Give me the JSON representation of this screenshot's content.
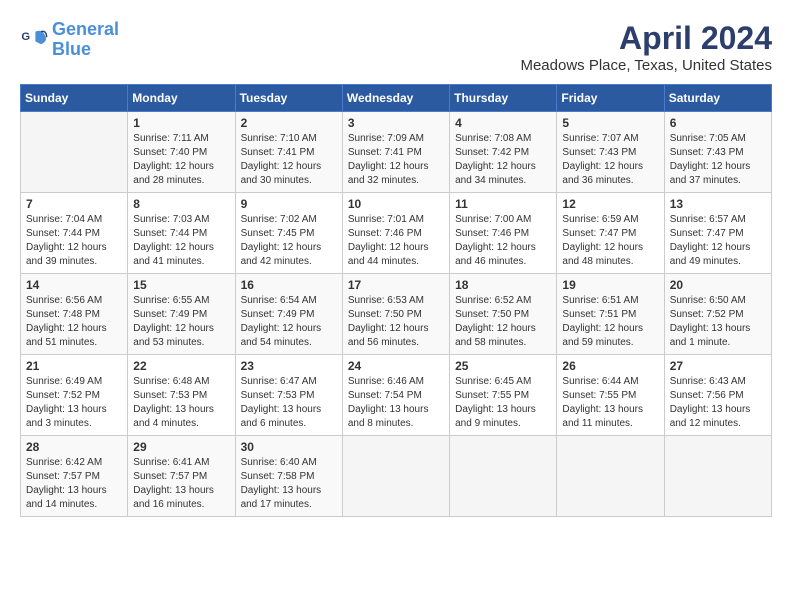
{
  "logo": {
    "line1": "General",
    "line2": "Blue"
  },
  "title": "April 2024",
  "location": "Meadows Place, Texas, United States",
  "days_header": [
    "Sunday",
    "Monday",
    "Tuesday",
    "Wednesday",
    "Thursday",
    "Friday",
    "Saturday"
  ],
  "weeks": [
    [
      {
        "day": "",
        "sunrise": "",
        "sunset": "",
        "daylight": ""
      },
      {
        "day": "1",
        "sunrise": "Sunrise: 7:11 AM",
        "sunset": "Sunset: 7:40 PM",
        "daylight": "Daylight: 12 hours and 28 minutes."
      },
      {
        "day": "2",
        "sunrise": "Sunrise: 7:10 AM",
        "sunset": "Sunset: 7:41 PM",
        "daylight": "Daylight: 12 hours and 30 minutes."
      },
      {
        "day": "3",
        "sunrise": "Sunrise: 7:09 AM",
        "sunset": "Sunset: 7:41 PM",
        "daylight": "Daylight: 12 hours and 32 minutes."
      },
      {
        "day": "4",
        "sunrise": "Sunrise: 7:08 AM",
        "sunset": "Sunset: 7:42 PM",
        "daylight": "Daylight: 12 hours and 34 minutes."
      },
      {
        "day": "5",
        "sunrise": "Sunrise: 7:07 AM",
        "sunset": "Sunset: 7:43 PM",
        "daylight": "Daylight: 12 hours and 36 minutes."
      },
      {
        "day": "6",
        "sunrise": "Sunrise: 7:05 AM",
        "sunset": "Sunset: 7:43 PM",
        "daylight": "Daylight: 12 hours and 37 minutes."
      }
    ],
    [
      {
        "day": "7",
        "sunrise": "Sunrise: 7:04 AM",
        "sunset": "Sunset: 7:44 PM",
        "daylight": "Daylight: 12 hours and 39 minutes."
      },
      {
        "day": "8",
        "sunrise": "Sunrise: 7:03 AM",
        "sunset": "Sunset: 7:44 PM",
        "daylight": "Daylight: 12 hours and 41 minutes."
      },
      {
        "day": "9",
        "sunrise": "Sunrise: 7:02 AM",
        "sunset": "Sunset: 7:45 PM",
        "daylight": "Daylight: 12 hours and 42 minutes."
      },
      {
        "day": "10",
        "sunrise": "Sunrise: 7:01 AM",
        "sunset": "Sunset: 7:46 PM",
        "daylight": "Daylight: 12 hours and 44 minutes."
      },
      {
        "day": "11",
        "sunrise": "Sunrise: 7:00 AM",
        "sunset": "Sunset: 7:46 PM",
        "daylight": "Daylight: 12 hours and 46 minutes."
      },
      {
        "day": "12",
        "sunrise": "Sunrise: 6:59 AM",
        "sunset": "Sunset: 7:47 PM",
        "daylight": "Daylight: 12 hours and 48 minutes."
      },
      {
        "day": "13",
        "sunrise": "Sunrise: 6:57 AM",
        "sunset": "Sunset: 7:47 PM",
        "daylight": "Daylight: 12 hours and 49 minutes."
      }
    ],
    [
      {
        "day": "14",
        "sunrise": "Sunrise: 6:56 AM",
        "sunset": "Sunset: 7:48 PM",
        "daylight": "Daylight: 12 hours and 51 minutes."
      },
      {
        "day": "15",
        "sunrise": "Sunrise: 6:55 AM",
        "sunset": "Sunset: 7:49 PM",
        "daylight": "Daylight: 12 hours and 53 minutes."
      },
      {
        "day": "16",
        "sunrise": "Sunrise: 6:54 AM",
        "sunset": "Sunset: 7:49 PM",
        "daylight": "Daylight: 12 hours and 54 minutes."
      },
      {
        "day": "17",
        "sunrise": "Sunrise: 6:53 AM",
        "sunset": "Sunset: 7:50 PM",
        "daylight": "Daylight: 12 hours and 56 minutes."
      },
      {
        "day": "18",
        "sunrise": "Sunrise: 6:52 AM",
        "sunset": "Sunset: 7:50 PM",
        "daylight": "Daylight: 12 hours and 58 minutes."
      },
      {
        "day": "19",
        "sunrise": "Sunrise: 6:51 AM",
        "sunset": "Sunset: 7:51 PM",
        "daylight": "Daylight: 12 hours and 59 minutes."
      },
      {
        "day": "20",
        "sunrise": "Sunrise: 6:50 AM",
        "sunset": "Sunset: 7:52 PM",
        "daylight": "Daylight: 13 hours and 1 minute."
      }
    ],
    [
      {
        "day": "21",
        "sunrise": "Sunrise: 6:49 AM",
        "sunset": "Sunset: 7:52 PM",
        "daylight": "Daylight: 13 hours and 3 minutes."
      },
      {
        "day": "22",
        "sunrise": "Sunrise: 6:48 AM",
        "sunset": "Sunset: 7:53 PM",
        "daylight": "Daylight: 13 hours and 4 minutes."
      },
      {
        "day": "23",
        "sunrise": "Sunrise: 6:47 AM",
        "sunset": "Sunset: 7:53 PM",
        "daylight": "Daylight: 13 hours and 6 minutes."
      },
      {
        "day": "24",
        "sunrise": "Sunrise: 6:46 AM",
        "sunset": "Sunset: 7:54 PM",
        "daylight": "Daylight: 13 hours and 8 minutes."
      },
      {
        "day": "25",
        "sunrise": "Sunrise: 6:45 AM",
        "sunset": "Sunset: 7:55 PM",
        "daylight": "Daylight: 13 hours and 9 minutes."
      },
      {
        "day": "26",
        "sunrise": "Sunrise: 6:44 AM",
        "sunset": "Sunset: 7:55 PM",
        "daylight": "Daylight: 13 hours and 11 minutes."
      },
      {
        "day": "27",
        "sunrise": "Sunrise: 6:43 AM",
        "sunset": "Sunset: 7:56 PM",
        "daylight": "Daylight: 13 hours and 12 minutes."
      }
    ],
    [
      {
        "day": "28",
        "sunrise": "Sunrise: 6:42 AM",
        "sunset": "Sunset: 7:57 PM",
        "daylight": "Daylight: 13 hours and 14 minutes."
      },
      {
        "day": "29",
        "sunrise": "Sunrise: 6:41 AM",
        "sunset": "Sunset: 7:57 PM",
        "daylight": "Daylight: 13 hours and 16 minutes."
      },
      {
        "day": "30",
        "sunrise": "Sunrise: 6:40 AM",
        "sunset": "Sunset: 7:58 PM",
        "daylight": "Daylight: 13 hours and 17 minutes."
      },
      {
        "day": "",
        "sunrise": "",
        "sunset": "",
        "daylight": ""
      },
      {
        "day": "",
        "sunrise": "",
        "sunset": "",
        "daylight": ""
      },
      {
        "day": "",
        "sunrise": "",
        "sunset": "",
        "daylight": ""
      },
      {
        "day": "",
        "sunrise": "",
        "sunset": "",
        "daylight": ""
      }
    ]
  ]
}
